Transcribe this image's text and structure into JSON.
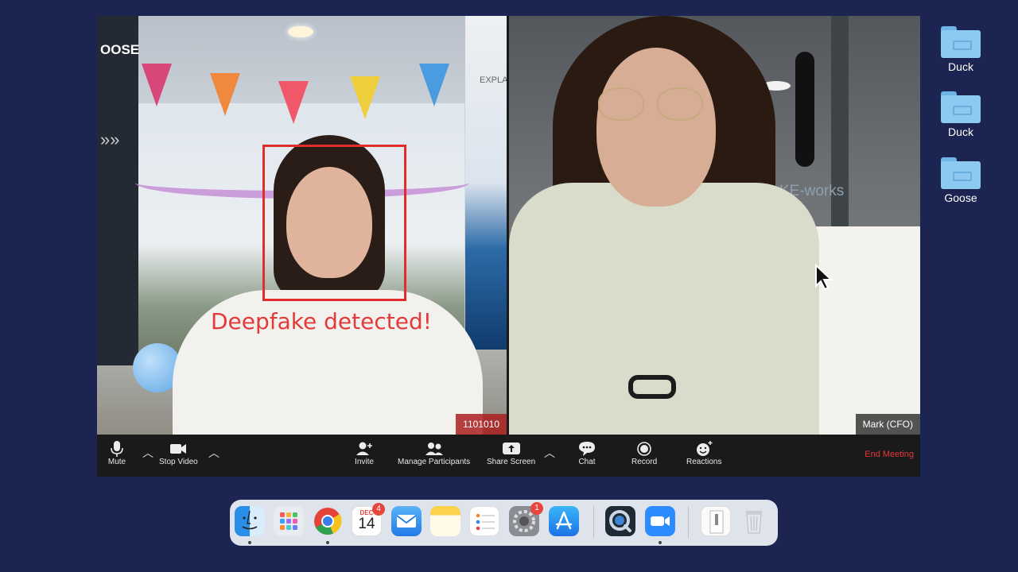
{
  "desktop": {
    "icons": [
      {
        "label": "Duck"
      },
      {
        "label": "Duck"
      },
      {
        "label": "Goose"
      }
    ]
  },
  "meeting": {
    "left_video": {
      "overlay_text": "Deepfake detected!",
      "name_tag": "1101010",
      "sign_text": "OOSE",
      "banner_text": "EXPLA"
    },
    "right_video": {
      "name_tag": "Mark (CFO)",
      "wall_text": "KE-works"
    },
    "toolbar": {
      "mute": "Mute",
      "stop_video": "Stop Video",
      "invite": "Invite",
      "participants": "Manage Participants",
      "share": "Share Screen",
      "chat": "Chat",
      "record": "Record",
      "reactions": "Reactions",
      "end": "End Meeting"
    }
  },
  "dock": {
    "calendar_month": "DEC",
    "calendar_day": "14",
    "calendar_badge": "4",
    "settings_badge": "1"
  },
  "colors": {
    "desktop_bg": "#1c2552",
    "detect_red": "#e22d2d",
    "end_meeting": "#e33a3a"
  }
}
